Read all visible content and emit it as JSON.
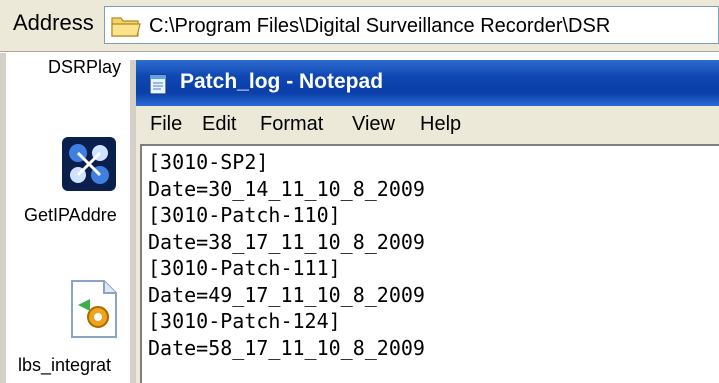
{
  "address_bar": {
    "label": "Address",
    "path": "C:\\Program Files\\Digital Surveillance Recorder\\DSR",
    "icon": "folder-icon"
  },
  "desktop": {
    "items": [
      {
        "label": "DSRPlay",
        "icon": "app-icon"
      },
      {
        "label": "GetIPAddre",
        "icon": "network-app-icon"
      },
      {
        "label": "lbs_integrat",
        "icon": "config-file-icon"
      }
    ]
  },
  "notepad": {
    "title": "Patch_log - Notepad",
    "icon": "notepad-icon",
    "menu": [
      "File",
      "Edit",
      "Format",
      "View",
      "Help"
    ],
    "lines": [
      "[3010-SP2]",
      "Date=30_14_11_10_8_2009",
      "[3010-Patch-110]",
      "Date=38_17_11_10_8_2009",
      "[3010-Patch-111]",
      "Date=49_17_11_10_8_2009",
      "[3010-Patch-124]",
      "Date=58_17_11_10_8_2009"
    ]
  }
}
